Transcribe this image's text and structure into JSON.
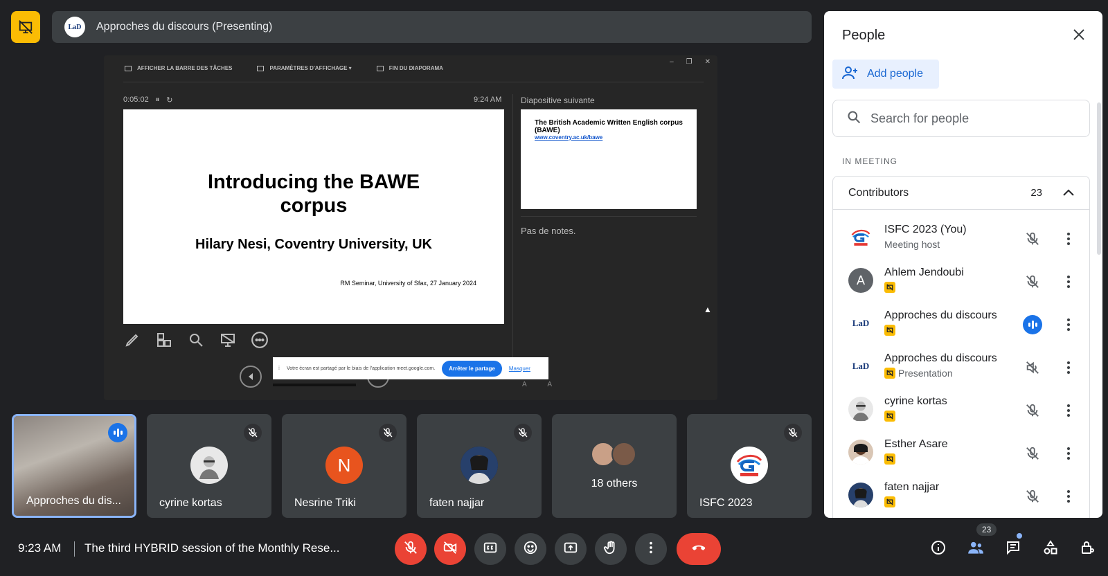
{
  "topbar": {
    "presenting_icon": "presentation-off-icon",
    "logo_text": "LaD",
    "title": "Approches du discours (Presenting)"
  },
  "screen": {
    "toolbar": [
      "AFFICHER LA BARRE DES TÂCHES",
      "PARAMÈTRES D'AFFICHAGE ▾",
      "FIN DU DIAPORAMA"
    ],
    "window_controls": [
      "–",
      "❐",
      "✕"
    ],
    "timer": "0:05:02",
    "clock": "9:24 AM",
    "next_label": "Diapositive suivante",
    "slide_title": "Introducing the BAWE corpus",
    "slide_author": "Hilary Nesi, Coventry University, UK",
    "slide_footer": "RM Seminar, University of Sfax, 27 January 2024",
    "next_slide_title": "The British Academic Written English corpus (BAWE)",
    "next_slide_link": "www.coventry.ac.uk/bawe",
    "notes": "Pas de notes.",
    "share_banner_text": "Votre écran est partagé par le biais de l'application meet.google.com.",
    "share_stop": "Arrêter le partage",
    "share_hide": "Masquer",
    "font_ctrl": "A A"
  },
  "tiles": [
    {
      "name": "Approches du dis...",
      "active": true
    },
    {
      "name": "cyrine kortas"
    },
    {
      "name": "Nesrine Triki",
      "initial": "N",
      "color": "#e8541e"
    },
    {
      "name": "faten najjar"
    },
    {
      "name": "18 others"
    },
    {
      "name": "ISFC 2023"
    }
  ],
  "bottombar": {
    "time": "9:23 AM",
    "separator": "|",
    "meeting_title": "The third HYBRID session of the Monthly Rese...",
    "people_badge": "23"
  },
  "panel": {
    "title": "People",
    "add_people": "Add people",
    "search_placeholder": "Search for people",
    "in_meeting": "IN MEETING",
    "contributors_label": "Contributors",
    "contributors_count": "23",
    "people": [
      {
        "name": "ISFC 2023 (You)",
        "sub": "Meeting host"
      },
      {
        "name": "Ahlem Jendoubi",
        "initial": "A"
      },
      {
        "name": "Approches du discours"
      },
      {
        "name": "Approches du discours",
        "sub": "Presentation"
      },
      {
        "name": "cyrine kortas"
      },
      {
        "name": "Esther Asare"
      },
      {
        "name": "faten najjar"
      }
    ]
  },
  "colors": {
    "accent": "#1a73e8",
    "danger": "#ea4335",
    "presenting": "#fbbc04",
    "bg": "#202124"
  }
}
